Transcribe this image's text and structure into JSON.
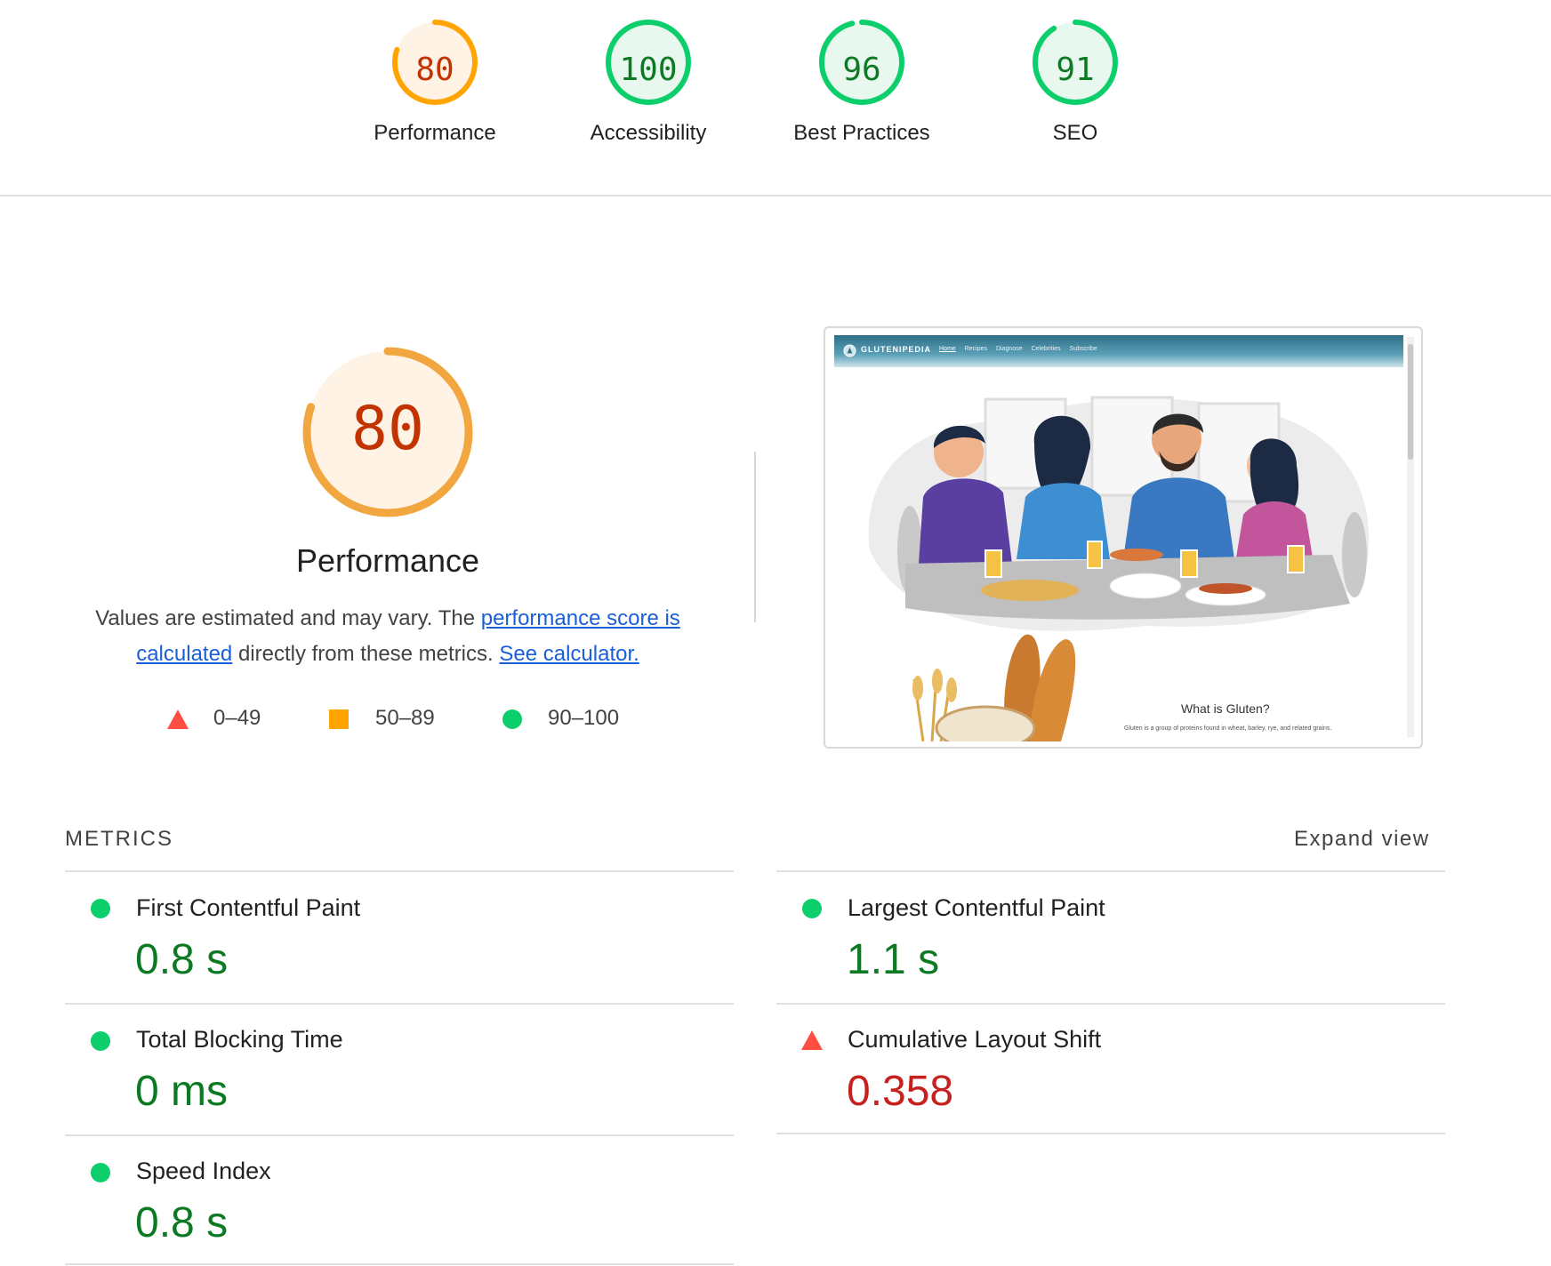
{
  "categories": [
    {
      "score": "80",
      "label": "Performance",
      "color": "#c33300",
      "ring": "#ffa400",
      "fill": "#fff3e6",
      "fraction": 0.8
    },
    {
      "score": "100",
      "label": "Accessibility",
      "color": "#0c7a23",
      "ring": "#0cce6b",
      "fill": "#e8f8ee",
      "fraction": 1.0
    },
    {
      "score": "96",
      "label": "Best Practices",
      "color": "#0c7a23",
      "ring": "#0cce6b",
      "fill": "#e8f8ee",
      "fraction": 0.96
    },
    {
      "score": "91",
      "label": "SEO",
      "color": "#0c7a23",
      "ring": "#0cce6b",
      "fill": "#e8f8ee",
      "fraction": 0.91
    }
  ],
  "performance": {
    "score": "80",
    "fraction": 0.8,
    "title": "Performance",
    "desc_prefix": "Values are estimated and may vary. The ",
    "link_score": "performance score is calculated",
    "desc_middle": " directly from these metrics. ",
    "link_calc": "See calculator."
  },
  "legend": [
    {
      "icon": "triangle-fail-icon",
      "range": "0–49"
    },
    {
      "icon": "square-average-icon",
      "range": "50–89"
    },
    {
      "icon": "circle-pass-icon",
      "range": "90–100"
    }
  ],
  "thumbnail": {
    "brand": "GLUTENIPEDIA",
    "nav": [
      "Home",
      "Recipes",
      "Diagnose",
      "Celebrities",
      "Subscribe"
    ],
    "heading": "What is Gluten?",
    "text": "Gluten is a group of proteins found in wheat, barley, rye, and related grains."
  },
  "metrics": {
    "title": "METRICS",
    "expand": "Expand view",
    "items": [
      {
        "label": "First Contentful Paint",
        "value": "0.8 s",
        "status": "pass"
      },
      {
        "label": "Largest Contentful Paint",
        "value": "1.1 s",
        "status": "pass"
      },
      {
        "label": "Total Blocking Time",
        "value": "0 ms",
        "status": "pass"
      },
      {
        "label": "Cumulative Layout Shift",
        "value": "0.358",
        "status": "fail"
      },
      {
        "label": "Speed Index",
        "value": "0.8 s",
        "status": "pass"
      }
    ]
  },
  "colors": {
    "pass": "#0cce6b",
    "average": "#ffa400",
    "fail": "#ff4e42",
    "link": "#1a5fd8"
  }
}
